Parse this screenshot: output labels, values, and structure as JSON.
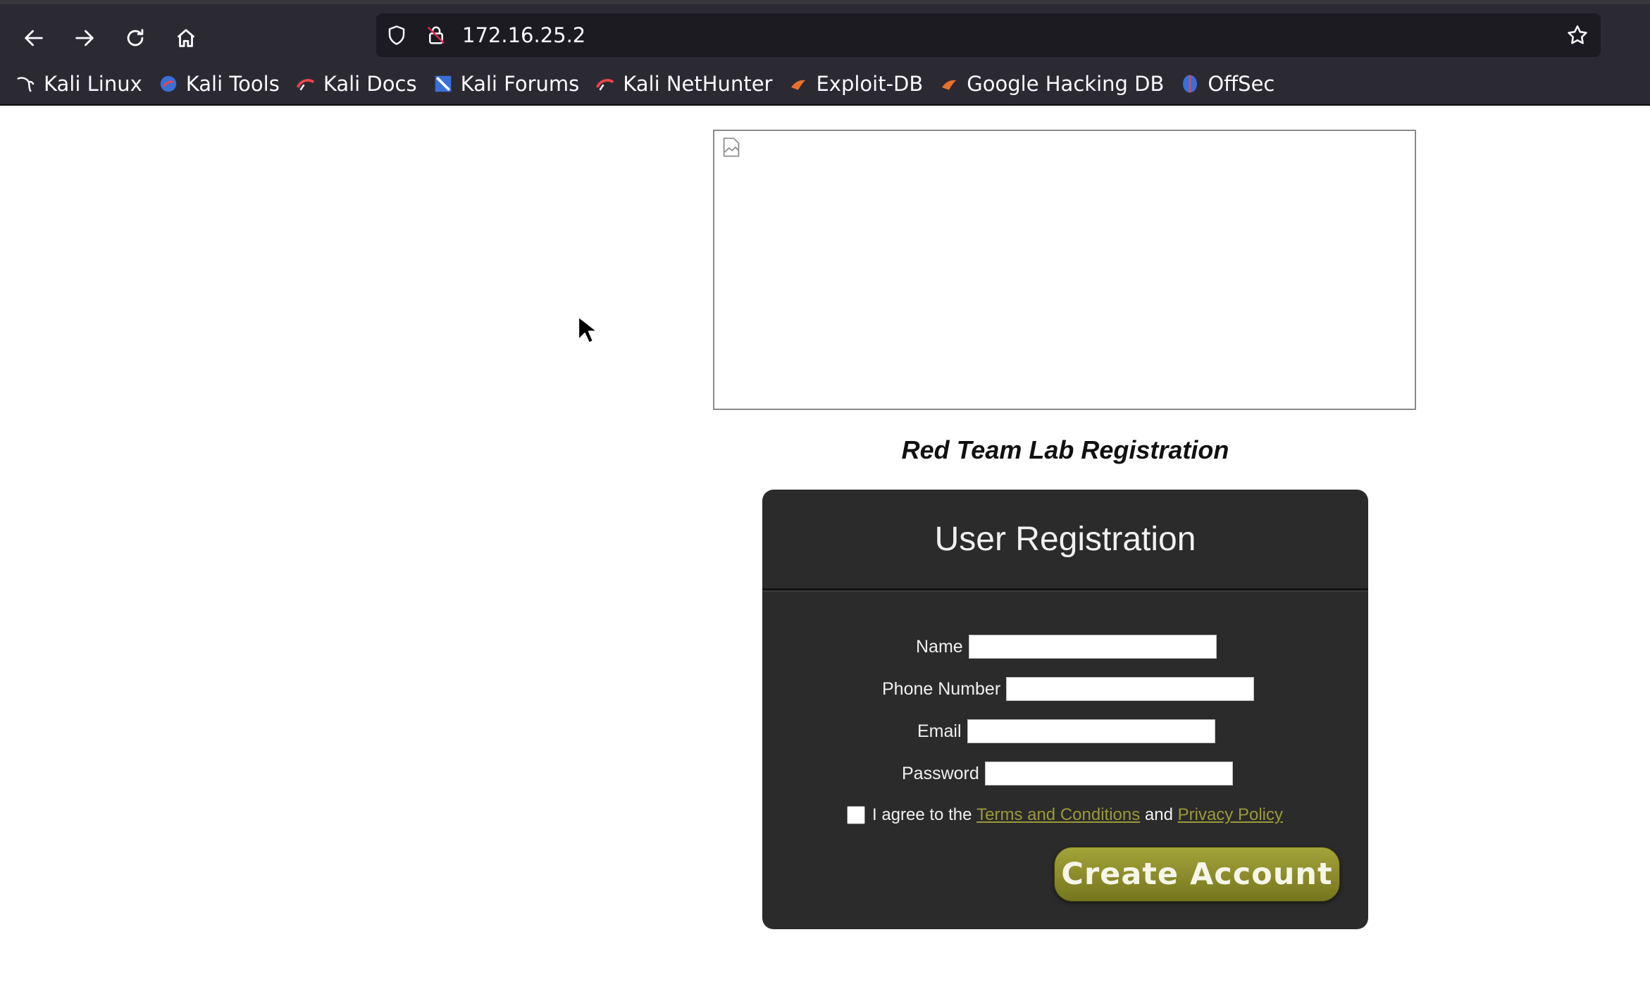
{
  "browser": {
    "url": "172.16.25.2",
    "bookmarks": [
      {
        "label": "Kali Linux",
        "icon": "kali-dragon-icon"
      },
      {
        "label": "Kali Tools",
        "icon": "kali-tools-icon"
      },
      {
        "label": "Kali Docs",
        "icon": "kali-docs-icon"
      },
      {
        "label": "Kali Forums",
        "icon": "kali-forums-icon"
      },
      {
        "label": "Kali NetHunter",
        "icon": "kali-nethunter-icon"
      },
      {
        "label": "Exploit-DB",
        "icon": "exploit-db-icon"
      },
      {
        "label": "Google Hacking DB",
        "icon": "ghdb-icon"
      },
      {
        "label": "OffSec",
        "icon": "offsec-icon"
      }
    ]
  },
  "page": {
    "lab_title": "Red Team Lab Registration",
    "form": {
      "heading": "User Registration",
      "fields": {
        "name_label": "Name",
        "phone_label": "Phone Number",
        "email_label": "Email",
        "password_label": "Password"
      },
      "agree_prefix": "I agree to the",
      "terms_link": "Terms and Conditions",
      "agree_and": "and",
      "privacy_link": "Privacy Policy",
      "submit_label": "Create Account"
    }
  },
  "colors": {
    "chrome_bg": "#2b2a33",
    "panel_bg": "#2b2b2b",
    "button_olive": "#8c8c2c",
    "link_olive": "#9a9a3a"
  }
}
